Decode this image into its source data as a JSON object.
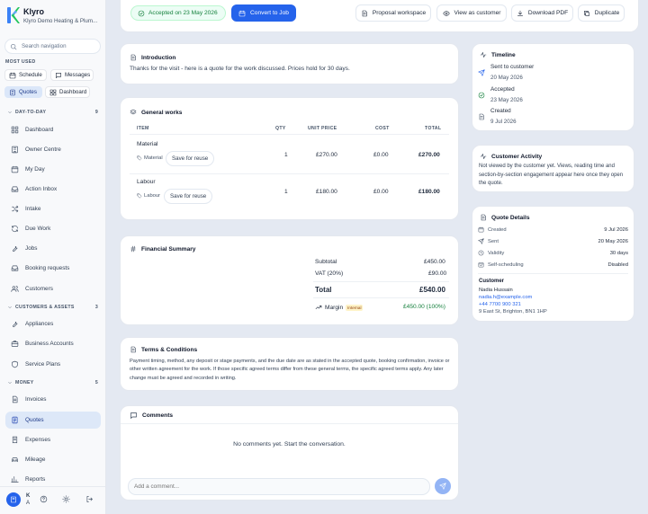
{
  "brand": {
    "name": "Klyro",
    "subtitle": "Klyro Demo Heating & Plum..."
  },
  "search": {
    "placeholder": "Search navigation"
  },
  "most_used": {
    "label": "MOST USED",
    "items": [
      "Schedule",
      "Messages",
      "Quotes",
      "Dashboard"
    ]
  },
  "sections": {
    "day_to_day": {
      "label": "DAY-TO-DAY",
      "count": "9",
      "items": [
        "Dashboard",
        "Owner Centre",
        "My Day",
        "Action Inbox",
        "Intake",
        "Due Work",
        "Jobs",
        "Booking requests",
        "Customers"
      ]
    },
    "customers_assets": {
      "label": "CUSTOMERS & ASSETS",
      "count": "3",
      "items": [
        "Appliances",
        "Business Accounts",
        "Service Plans"
      ]
    },
    "money": {
      "label": "MONEY",
      "count": "5",
      "items": [
        "Invoices",
        "Quotes",
        "Expenses",
        "Mileage",
        "Reports"
      ]
    }
  },
  "footer": {
    "initial": "K",
    "sub": "A"
  },
  "toolbar": {
    "accepted": "Accepted on 23 May 2026",
    "convert": "Convert to Job",
    "proposal": "Proposal workspace",
    "view_customer": "View as customer",
    "download": "Download PDF",
    "duplicate": "Duplicate"
  },
  "introduction": {
    "title": "Introduction",
    "text": "Thanks for the visit - here is a quote for the work discussed. Prices hold for 30 days."
  },
  "general_works": {
    "title": "General works",
    "headers": {
      "item": "ITEM",
      "qty": "QTY",
      "unit_price": "UNIT PRICE",
      "cost": "COST",
      "total": "TOTAL"
    },
    "rows": [
      {
        "name": "Material",
        "tag": "Material",
        "reuse": "Save for reuse",
        "qty": "1",
        "unit_price": "£270.00",
        "cost": "£0.00",
        "total": "£270.00"
      },
      {
        "name": "Labour",
        "tag": "Labour",
        "reuse": "Save for reuse",
        "qty": "1",
        "unit_price": "£180.00",
        "cost": "£0.00",
        "total": "£180.00"
      }
    ]
  },
  "financial": {
    "title": "Financial Summary",
    "subtotal_label": "Subtotal",
    "subtotal": "£450.00",
    "vat_label": "VAT (20%)",
    "vat": "£90.00",
    "total_label": "Total",
    "total": "£540.00",
    "margin_label": "Margin",
    "margin_badge": "Internal",
    "margin": "£450.00 (100%)"
  },
  "terms": {
    "title": "Terms & Conditions",
    "text": "Payment timing, method, any deposit or stage payments, and the due date are as stated in the accepted quote, booking confirmation, invoice or other written agreement for the work. If those specific agreed terms differ from these general terms, the specific agreed terms apply. Any later change must be agreed and recorded in writing."
  },
  "comments": {
    "title": "Comments",
    "empty": "No comments yet. Start the conversation.",
    "placeholder": "Add a comment..."
  },
  "timeline": {
    "title": "Timeline",
    "items": [
      {
        "label": "Sent to customer",
        "date": "20 May 2026"
      },
      {
        "label": "Accepted",
        "date": "23 May 2026"
      },
      {
        "label": "Created",
        "date": "9 Jul 2026"
      }
    ]
  },
  "activity": {
    "title": "Customer Activity",
    "text": "Not viewed by the customer yet. Views, reading time and section-by-section engagement appear here once they open the quote."
  },
  "quote_details": {
    "title": "Quote Details",
    "rows": [
      {
        "label": "Created",
        "value": "9 Jul 2026"
      },
      {
        "label": "Sent",
        "value": "20 May 2026"
      },
      {
        "label": "Validity",
        "value": "30 days"
      },
      {
        "label": "Self-scheduling",
        "value": "Disabled"
      }
    ],
    "customer_label": "Customer",
    "customer_name": "Nadia Hussain",
    "customer_email": "nadia.h@example.com",
    "customer_phone": "+44 7700 900 321",
    "customer_address": "9 East St, Brighton, BN1 1HP"
  },
  "colors": {
    "accent": "#2563eb",
    "success": "#15803d",
    "active_bg": "#dde8f8"
  }
}
